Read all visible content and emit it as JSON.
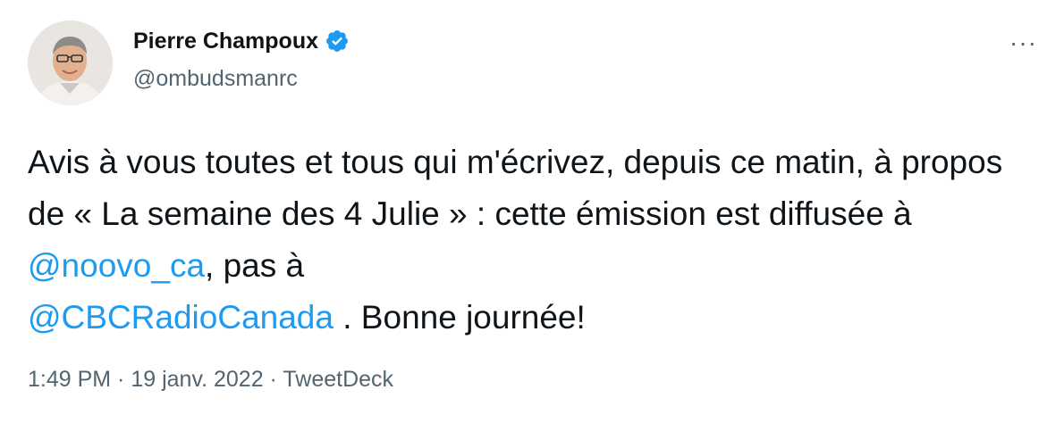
{
  "author": {
    "name": "Pierre Champoux",
    "handle": "@ombudsmanrc",
    "verified": true,
    "verified_color": "#1d9bf0"
  },
  "more_label": "···",
  "tweet": {
    "text_1": "Avis à vous toutes et tous qui m'écrivez, depuis ce matin, à propos de « La semaine des 4 Julie » : cette émission est diffusée à ",
    "mention_1": "@noovo_ca",
    "text_2": ", pas à ",
    "mention_2": "@CBCRadioCanada",
    "text_3": " . Bonne journée!"
  },
  "meta": {
    "time": "1:49 PM",
    "sep1": " · ",
    "date": "19 janv. 2022",
    "sep2": " · ",
    "source": "TweetDeck"
  },
  "colors": {
    "text": "#0f1419",
    "secondary": "#536471",
    "link": "#1d9bf0"
  }
}
